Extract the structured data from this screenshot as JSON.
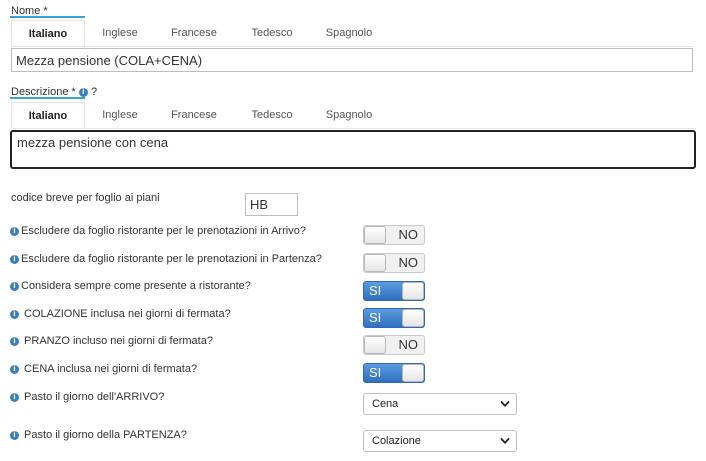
{
  "nome": {
    "label": "Nome *",
    "tabs": [
      "Italiano",
      "Inglese",
      "Francese",
      "Tedesco",
      "Spagnolo"
    ],
    "active_tab": "Italiano",
    "value": "Mezza pensione (COLA+CENA)"
  },
  "descrizione": {
    "label": "Descrizione *",
    "help": "?",
    "tabs": [
      "Italiano",
      "Inglese",
      "Francese",
      "Tedesco",
      "Spagnolo"
    ],
    "active_tab": "Italiano",
    "value": "mezza pensione con cena"
  },
  "codice": {
    "label": "codice breve per foglio ai piani",
    "value": "HB"
  },
  "info_glyph": "i",
  "toggles": [
    {
      "label": "Escludere da foglio ristorante per le prenotazioni in Arrivo?",
      "state": "NO"
    },
    {
      "label": "Escludere da foglio ristorante per le prenotazioni in Partenza?",
      "state": "NO"
    },
    {
      "label": "Considera sempre come presente a ristorante?",
      "state": "SI"
    },
    {
      "label": " COLAZIONE inclusa nei giorni di fermata?",
      "state": "SI"
    },
    {
      "label": " PRANZO incluso nei giorni di fermata?",
      "state": "NO"
    },
    {
      "label": " CENA inclusa nei giorni di fermata?",
      "state": "SI"
    }
  ],
  "selects": [
    {
      "label": " Pasto il giorno dell'ARRIVO?",
      "value": "Cena"
    },
    {
      "label": " Pasto il giorno della PARTENZA?",
      "value": "Colazione"
    }
  ],
  "colors": {
    "accent_underline": "#3ba2d6",
    "info_icon": "#3a7fc0",
    "toggle_on": "#2f6fbf"
  },
  "icons": {
    "info": "info-icon",
    "select_arrow": "chevron-down-icon"
  }
}
